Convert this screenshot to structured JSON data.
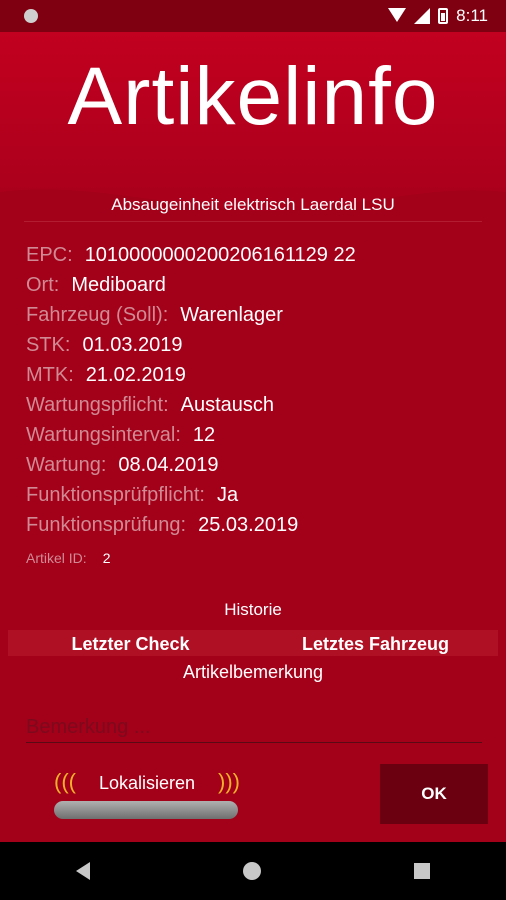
{
  "status_bar": {
    "time": "8:11"
  },
  "header": {
    "title": "Artikelinfo",
    "subtitle": "Absaugeinheit elektrisch Laerdal LSU"
  },
  "details": [
    {
      "label": "EPC:",
      "value": "1010000000200206161129 22"
    },
    {
      "label": "Ort:",
      "value": "Mediboard"
    },
    {
      "label": "Fahrzeug (Soll):",
      "value": "Warenlager"
    },
    {
      "label": "STK:",
      "value": "01.03.2019"
    },
    {
      "label": "MTK:",
      "value": "21.02.2019"
    },
    {
      "label": "Wartungspflicht:",
      "value": "Austausch"
    },
    {
      "label": "Wartungsinterval:",
      "value": "12"
    },
    {
      "label": "Wartung:",
      "value": "08.04.2019"
    },
    {
      "label": "Funktionsprüfpflicht:",
      "value": "Ja"
    },
    {
      "label": "Funktionsprüfung:",
      "value": "25.03.2019"
    }
  ],
  "artikel_id": {
    "label": "Artikel ID:",
    "value": "2"
  },
  "historie": {
    "title": "Historie",
    "columns": [
      "Letzter Check",
      "Letztes Fahrzeug"
    ]
  },
  "bemerkung": {
    "title": "Artikelbemerkung",
    "placeholder": "Bemerkung ..."
  },
  "lokalisieren": {
    "label": "Lokalisieren"
  },
  "ok_button": {
    "label": "OK"
  },
  "colors": {
    "primary": "#a3001a",
    "dark": "#6a0010",
    "status": "#7e0011",
    "muted_label": "#d08a93"
  }
}
